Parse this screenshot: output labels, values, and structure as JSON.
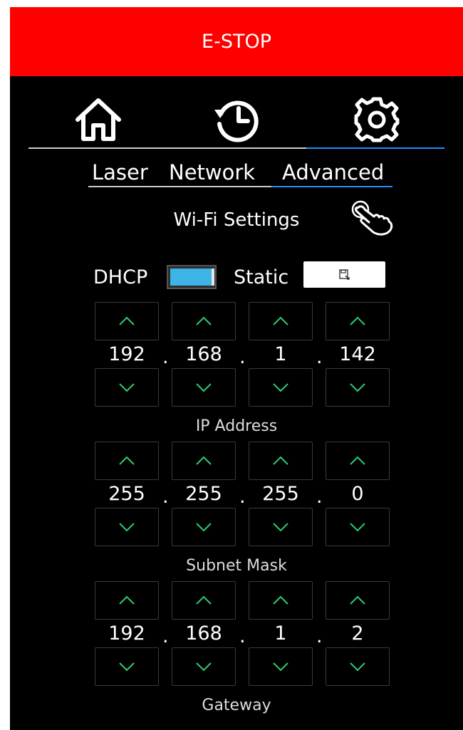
{
  "estop": {
    "label": "E-STOP"
  },
  "nav": {
    "items": [
      "home",
      "history",
      "settings"
    ],
    "active": "settings",
    "active_color": "#1e90ff"
  },
  "subtabs": {
    "items": [
      "Laser",
      "Network",
      "Advanced"
    ],
    "active": "Advanced"
  },
  "wifi": {
    "title": "Wi-Fi Settings",
    "dhcp_label": "DHCP",
    "static_label": "Static",
    "dhcp_color": "#3cb4e5"
  },
  "separator": ".",
  "fields": [
    {
      "label": "IP Address",
      "octets": [
        "192",
        "168",
        "1",
        "142"
      ]
    },
    {
      "label": "Subnet Mask",
      "octets": [
        "255",
        "255",
        "255",
        "0"
      ]
    },
    {
      "label": "Gateway",
      "octets": [
        "192",
        "168",
        "1",
        "2"
      ]
    }
  ],
  "colors": {
    "estop": "#ff0000",
    "chevron": "#2ecc71",
    "background": "#000000"
  }
}
